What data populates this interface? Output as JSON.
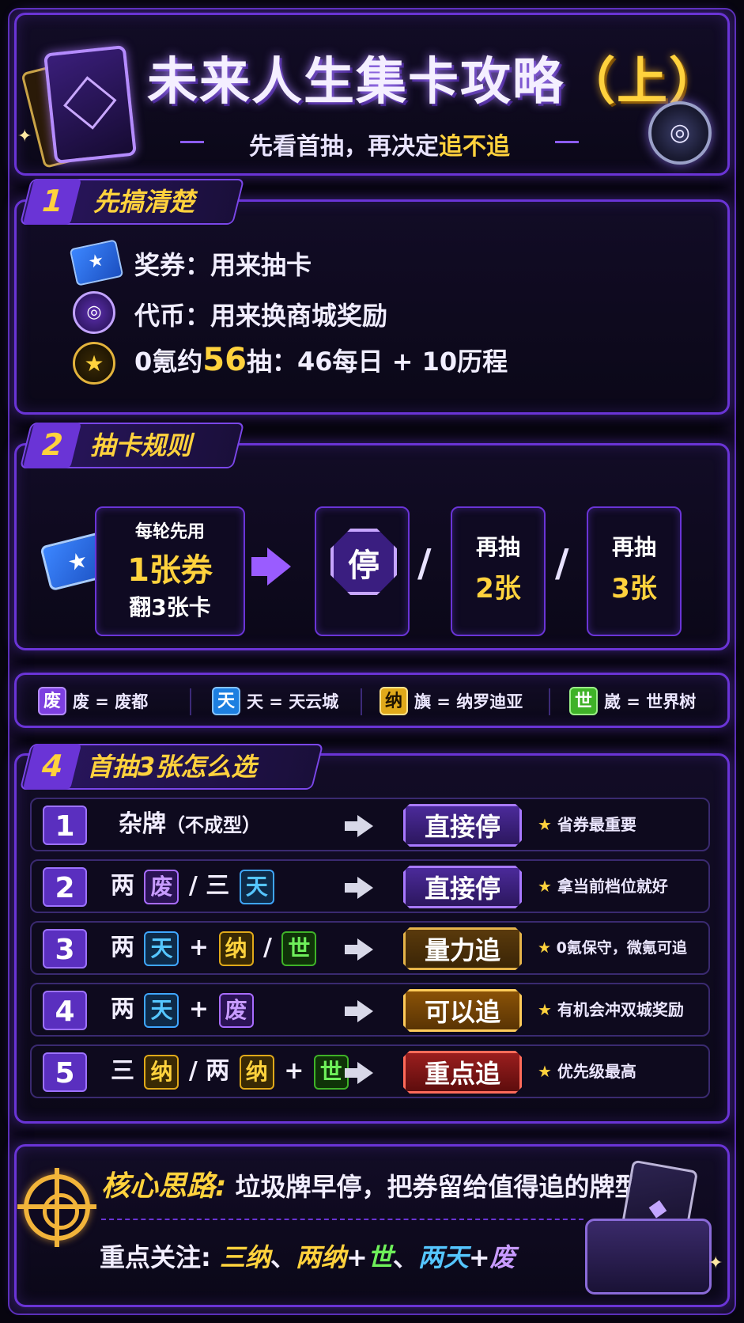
{
  "header": {
    "title": "未来人生集卡攻略",
    "title_part": "（上）",
    "subtitle_prefix": "先看首抽，再决定",
    "subtitle_highlight": "追不追"
  },
  "section1": {
    "num": "1",
    "title": "先搞清楚",
    "rows": [
      {
        "icon": "ticket-icon",
        "text": "奖券：用来抽卡"
      },
      {
        "icon": "token-coin-icon",
        "text": "代币：用来换商城奖励"
      },
      {
        "icon": "star-badge-icon",
        "pre": "0氪约",
        "big": "56",
        "post": "抽：46每日 + 10历程"
      }
    ]
  },
  "section2": {
    "num": "2",
    "title": "抽卡规则",
    "box1": {
      "line1": "每轮先用",
      "line2": "1张券",
      "line3": "翻3张卡"
    },
    "stop": "停",
    "slash": "/",
    "box2": {
      "line1": "再抽",
      "line2": "2张"
    },
    "box3": {
      "line1": "再抽",
      "line2": "3张"
    }
  },
  "legend": [
    {
      "chip": "废",
      "text": "废 = 废都"
    },
    {
      "chip": "天",
      "text": "天 = 天云城"
    },
    {
      "chip": "纳",
      "text": "旟 = 纳罗迪亚"
    },
    {
      "chip": "世",
      "text": "崴 = 世界树"
    }
  ],
  "section4": {
    "num": "4",
    "title": "首抽3张怎么选",
    "rows": [
      {
        "num": "1",
        "combo_main": "杂牌",
        "combo_paren": "（不成型）",
        "action": "直接停",
        "note": "省券最重要"
      },
      {
        "num": "2",
        "pre": "两",
        "t1": "废",
        "mid": "/ 三",
        "t2": "天",
        "action": "直接停",
        "note": "拿当前档位就好"
      },
      {
        "num": "3",
        "pre": "两",
        "t1": "天",
        "mid": "+",
        "t2": "纳",
        "mid2": "/",
        "t3": "世",
        "action": "量力追",
        "note": "0氪保守，微氪可追"
      },
      {
        "num": "4",
        "pre": "两",
        "t1": "天",
        "mid": "+",
        "t2": "废",
        "action": "可以追",
        "note": "有机会冲双城奖励"
      },
      {
        "num": "5",
        "pre": "三",
        "t1": "纳",
        "mid": "/ 两",
        "t2": "纳",
        "mid2": "+",
        "t3": "世",
        "action": "重点追",
        "note": "优先级最高"
      }
    ],
    "star": "★"
  },
  "bottom": {
    "core_label": "核心思路:",
    "core_text": "垃圾牌早停，把券留给值得追的牌型。",
    "focus_label": "重点关注:",
    "focus_1": "三纳",
    "focus_sep1": "、",
    "focus_2": "两纳",
    "focus_plus1": "+",
    "focus_3": "世",
    "focus_sep2": "、",
    "focus_4": "两天",
    "focus_plus2": "+",
    "focus_5": "废"
  },
  "colors": {
    "accent": "#6a34d6",
    "gold": "#ffd23d",
    "blue": "#55c6ff",
    "green": "#6ef05a",
    "purple": "#c89bff"
  }
}
